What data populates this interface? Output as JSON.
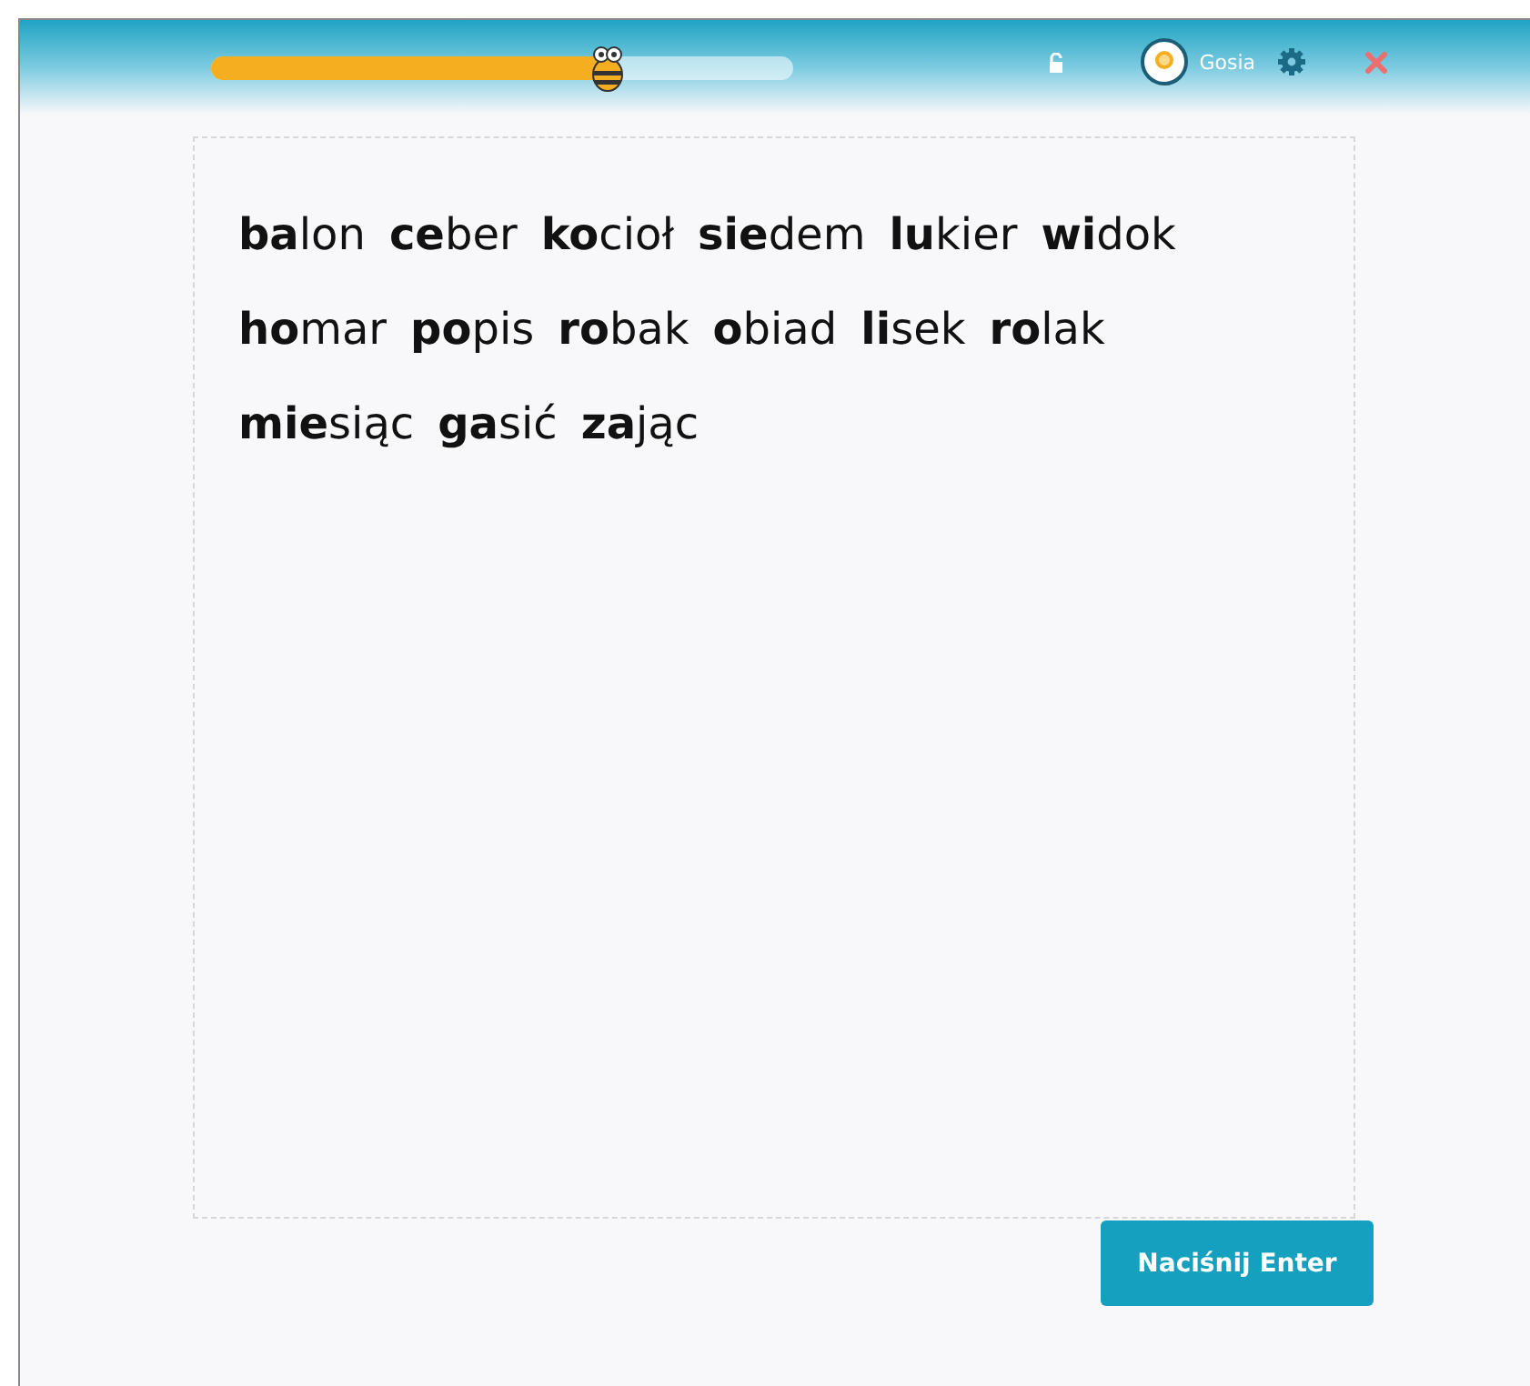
{
  "header": {
    "progress": {
      "level": 0.68
    },
    "user": {
      "name": "Gosia"
    }
  },
  "lines": [
    [
      "**ba**lon",
      "**ce**ber",
      "**ko**cioł",
      "**sie**dem",
      "**lu**kier",
      "**wi**dok"
    ],
    [
      "**ho**mar",
      "**po**pis",
      "**ro**bak",
      "**o**biad",
      "**li**sek",
      "**ro**lak"
    ],
    [
      "**mie**siąc",
      "**ga**sić",
      "**za**jąc"
    ]
  ],
  "button": {
    "label": "Naciśnij Enter"
  }
}
